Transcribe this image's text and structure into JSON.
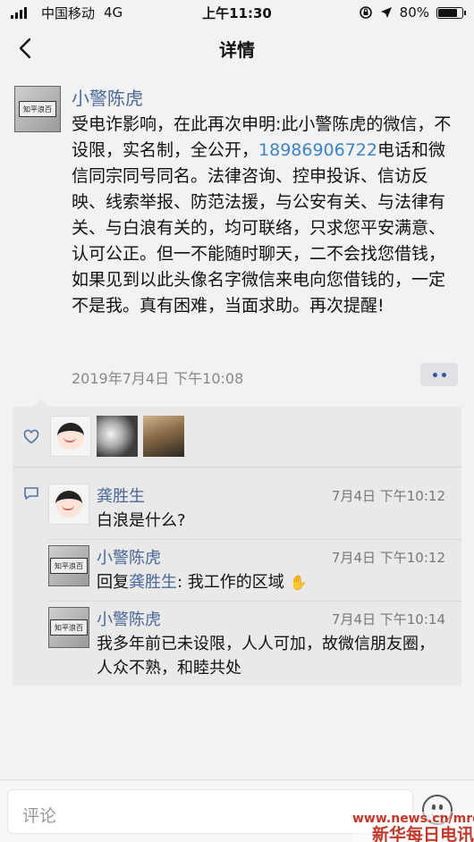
{
  "status_bar": {
    "carrier": "中国移动",
    "network": "4G",
    "time": "上午11:30",
    "battery": "80%",
    "battery_level": 0.8
  },
  "nav": {
    "title": "详情",
    "back_icon": "chevron-left-icon"
  },
  "post": {
    "author": "小警陈虎",
    "avatar_board_text": "知平浪百",
    "body_before_phone": "受电诈影响，在此再次申明:此小警陈虎的微信，不设限，实名制，全公开，",
    "phone": "18986906722",
    "body_after_phone": "电话和微信同宗同号同名。法律咨询、控申投诉、信访反映、线索举报、防范法援，与公安有关、与法律有关、与白浪有关的，均可联络，只求您平安满意、认可公正。但一不能随时聊天，二不会找您借钱，如果见到以此头像名字微信来电向您借钱的，一定不是我。真有困难，当面求助。再次提醒!",
    "date": "2019年7月4日  下午10:08",
    "more_icon": "more-dots-icon"
  },
  "likes": {
    "icon": "heart-icon",
    "count": 3
  },
  "comments": [
    {
      "author": "龚胜生",
      "time": "7月4日 下午10:12",
      "text": "白浪是什么?"
    },
    {
      "author": "小警陈虎",
      "time": "7月4日 下午10:12",
      "reply_prefix": "回复",
      "reply_to": "龚胜生",
      "text": ": 我工作的区域",
      "emoji": "praying-hands-emoji"
    },
    {
      "author": "小警陈虎",
      "time": "7月4日 下午10:14",
      "text": "我多年前已未设限，人人可加，故微信朋友圈，人众不熟，和睦共处"
    }
  ],
  "comment_bar": {
    "placeholder": "评论",
    "emoji_icon": "smiley-icon"
  },
  "watermark": {
    "url": "www.news.cn/mrdx",
    "name": "新华每日电讯"
  }
}
